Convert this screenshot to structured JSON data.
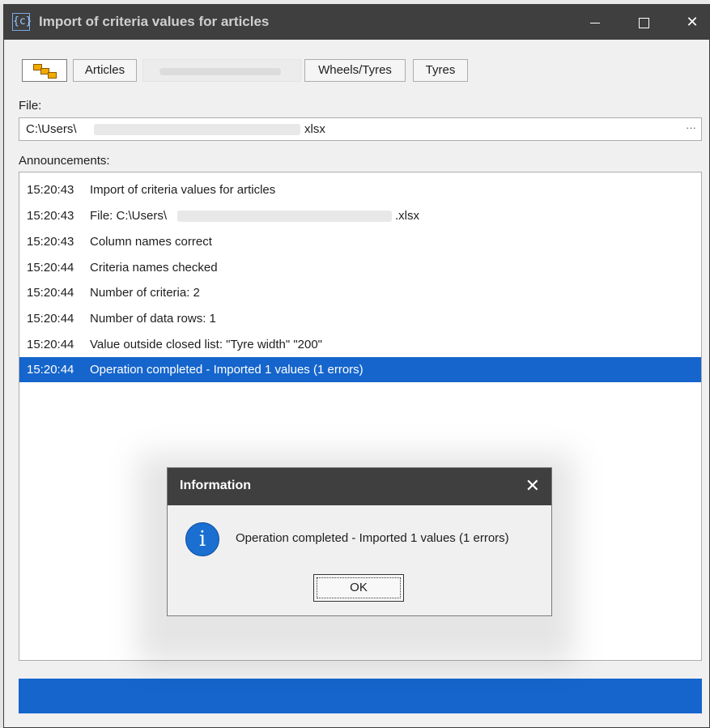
{
  "window": {
    "title": "Import of criteria values for articles",
    "icon": "criteria-import-icon"
  },
  "toolbar": {
    "tree_icon": "tree-view-icon",
    "articles_label": "Articles",
    "wheels_tyres_label": "Wheels/Tyres",
    "tyres_label": "Tyres"
  },
  "file": {
    "label": "File:",
    "value_prefix": "C:\\Users\\",
    "value_suffix": "xlsx",
    "browse_label": "···"
  },
  "announcements": {
    "label": "Announcements:",
    "rows": [
      {
        "time": "15:20:43",
        "text": "Import of criteria values for articles"
      },
      {
        "time": "15:20:43",
        "text": "File: C:\\Users\\",
        "tail": ".xlsx"
      },
      {
        "time": "15:20:43",
        "text": "Column names correct"
      },
      {
        "time": "15:20:44",
        "text": "Criteria names checked"
      },
      {
        "time": "15:20:44",
        "text": "Number of criteria: 2"
      },
      {
        "time": "15:20:44",
        "text": "Number of data rows: 1"
      },
      {
        "time": "15:20:44",
        "text": "Value outside closed list: \"Tyre width\" \"200\""
      },
      {
        "time": "15:20:44",
        "text": "Operation completed - Imported 1 values (1 errors)"
      }
    ],
    "selected_index": 7
  },
  "progress": {
    "fraction": 1.0,
    "color": "#1565cc"
  },
  "dialog": {
    "title": "Information",
    "close_glyph": "✕",
    "icon": "info-icon",
    "icon_glyph": "i",
    "message": "Operation completed - Imported 1 values (1 errors)",
    "ok_label": "OK"
  },
  "colors": {
    "titlebar": "#3f3f3f",
    "accent": "#1565cc",
    "background": "#f0f0f0"
  }
}
